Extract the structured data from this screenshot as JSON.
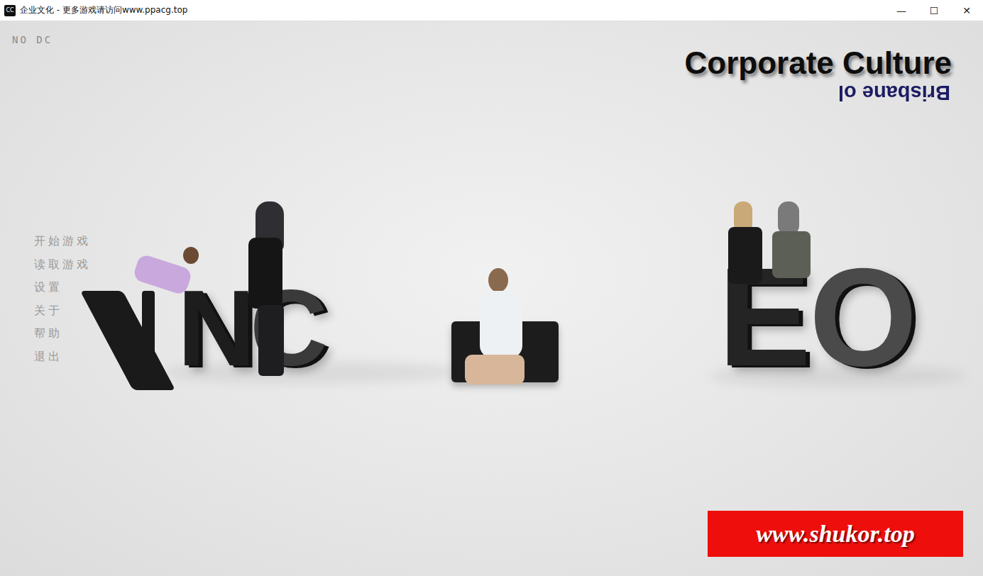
{
  "window": {
    "title": "企业文化 - 更多游戏请访问www.ppacg.top",
    "icon": "CC",
    "controls": [
      "—",
      "☐",
      "✕"
    ]
  },
  "corner_label": "NO DC",
  "title": "Corporate Culture",
  "subtitle": "Brisbane ol",
  "menu": [
    {
      "label": "开始游戏"
    },
    {
      "label": "读取游戏"
    },
    {
      "label": "设置"
    },
    {
      "label": "关于"
    },
    {
      "label": "帮助"
    },
    {
      "label": "退出"
    }
  ],
  "scene_letters": [
    "N",
    "C",
    "E",
    "O"
  ],
  "watermark": "www.shukor.top"
}
